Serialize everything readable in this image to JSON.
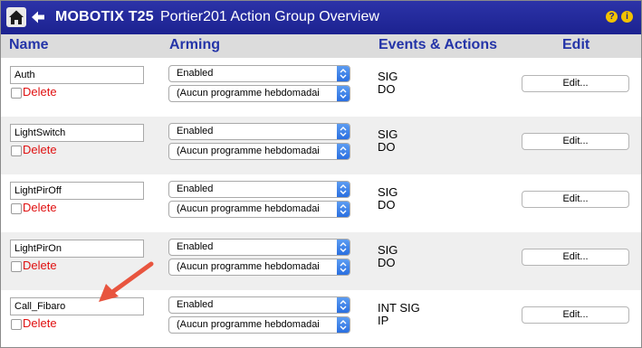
{
  "window": {
    "brand": "MOBOTIX T25",
    "page_title": "Portier201 Action Group Overview",
    "help_symbol": "?",
    "info_symbol": "i"
  },
  "columns": {
    "name": "Name",
    "arming": "Arming",
    "events": "Events & Actions",
    "edit": "Edit"
  },
  "colors": {
    "titlebar": "#1c2290",
    "header_text": "#2434a8",
    "delete_text": "#e01010",
    "annotation_arrow": "#e8553f"
  },
  "rows": [
    {
      "name_value": "Auth",
      "delete_label": "Delete",
      "arming": "Enabled",
      "schedule": "(Aucun programme hebdomadai",
      "events_line1": "SIG",
      "events_line2": "DO",
      "edit_label": "Edit..."
    },
    {
      "name_value": "LightSwitch",
      "delete_label": "Delete",
      "arming": "Enabled",
      "schedule": "(Aucun programme hebdomadai",
      "events_line1": "SIG",
      "events_line2": "DO",
      "edit_label": "Edit..."
    },
    {
      "name_value": "LightPirOff",
      "delete_label": "Delete",
      "arming": "Enabled",
      "schedule": "(Aucun programme hebdomadai",
      "events_line1": "SIG",
      "events_line2": "DO",
      "edit_label": "Edit..."
    },
    {
      "name_value": "LightPirOn",
      "delete_label": "Delete",
      "arming": "Enabled",
      "schedule": "(Aucun programme hebdomadai",
      "events_line1": "SIG",
      "events_line2": "DO",
      "edit_label": "Edit..."
    },
    {
      "name_value": "Call_Fibaro",
      "delete_label": "Delete",
      "arming": "Enabled",
      "schedule": "(Aucun programme hebdomadai",
      "events_line1": "INT SIG",
      "events_line2": "IP",
      "edit_label": "Edit..."
    }
  ]
}
